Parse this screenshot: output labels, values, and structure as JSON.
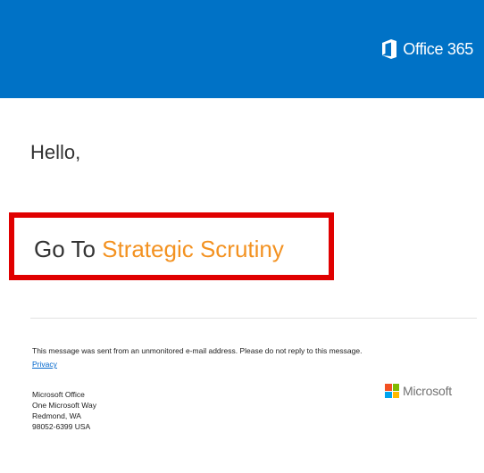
{
  "header": {
    "brand_name": "Office 365",
    "brand_icon": "office-icon",
    "background_color": "#0072c6"
  },
  "body": {
    "greeting": "Hello,",
    "cta_prefix": "Go To ",
    "cta_link_text": "Strategic Scrutiny",
    "cta_link_color": "#f39221",
    "highlight_box_color": "#e00000"
  },
  "footer": {
    "notice": "This message was sent from an unmonitored e-mail address. Please do not reply to this message.",
    "privacy_label": "Privacy",
    "address_lines": [
      "Microsoft Office",
      "One Microsoft Way",
      "Redmond, WA",
      "98052-6399 USA"
    ],
    "logo_text": "Microsoft",
    "logo_icon": "microsoft-logo-icon",
    "logo_colors": [
      "#f25022",
      "#7fba00",
      "#00a4ef",
      "#ffb900"
    ]
  }
}
